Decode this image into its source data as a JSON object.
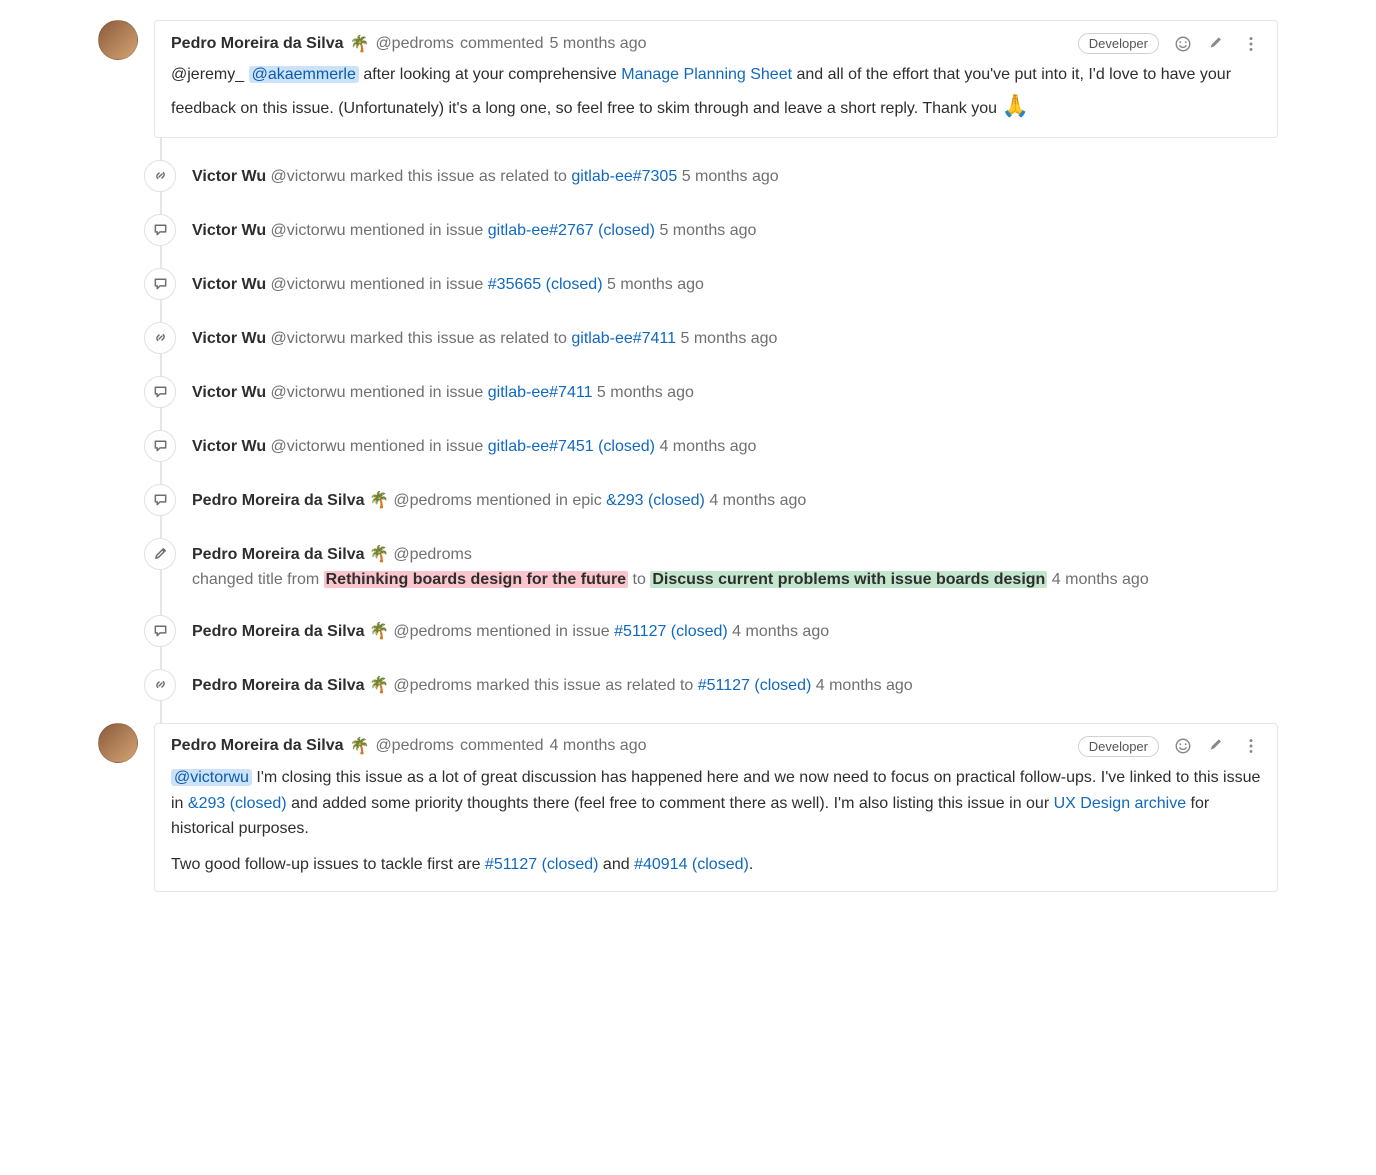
{
  "badge": {
    "developer": "Developer"
  },
  "comment1": {
    "author": "Pedro Moreira da Silva",
    "emoji": "🌴",
    "handle": "@pedroms",
    "verb": "commented",
    "time": "5 months ago",
    "seg": {
      "mention1": "@jeremy_",
      "mention2_hl": "@akaemmerle",
      "t1": " after looking at your comprehensive ",
      "link1": "Manage Planning Sheet",
      "t2": " and all of the effort that you've put into it, I'd love to have your feedback on this issue. (Unfortunately) it's a long one, so feel free to skim through and leave a short reply. Thank you "
    },
    "pray": "🙏"
  },
  "notes": [
    {
      "icon": "link",
      "author": "Victor Wu",
      "handle": "@victorwu",
      "action": " marked this issue as related to ",
      "ref": "gitlab-ee#7305",
      "time": "5 months ago"
    },
    {
      "icon": "speech",
      "author": "Victor Wu",
      "handle": "@victorwu",
      "action": " mentioned in issue ",
      "ref": "gitlab-ee#2767 (closed)",
      "time": "5 months ago"
    },
    {
      "icon": "speech",
      "author": "Victor Wu",
      "handle": "@victorwu",
      "action": " mentioned in issue ",
      "ref": "#35665 (closed)",
      "time": "5 months ago"
    },
    {
      "icon": "link",
      "author": "Victor Wu",
      "handle": "@victorwu",
      "action": " marked this issue as related to ",
      "ref": "gitlab-ee#7411",
      "time": "5 months ago"
    },
    {
      "icon": "speech",
      "author": "Victor Wu",
      "handle": "@victorwu",
      "action": " mentioned in issue ",
      "ref": "gitlab-ee#7411",
      "time": "5 months ago"
    },
    {
      "icon": "speech",
      "author": "Victor Wu",
      "handle": "@victorwu",
      "action": " mentioned in issue ",
      "ref": "gitlab-ee#7451 (closed)",
      "time": "4 months ago"
    },
    {
      "icon": "speech",
      "author": "Pedro Moreira da Silva",
      "emoji": "🌴",
      "handle": "@pedroms",
      "action": " mentioned in epic ",
      "ref": "&293 (closed)",
      "time": "4 months ago"
    },
    {
      "icon": "pencil",
      "author": "Pedro Moreira da Silva",
      "emoji": "🌴",
      "handle": "@pedroms",
      "title_change": true,
      "prefix": "changed title from ",
      "old": "Rethinking boards design for the future",
      "mid": " to ",
      "new": "Discuss current problems with issue boards design",
      "time": "4 months ago"
    },
    {
      "icon": "speech",
      "author": "Pedro Moreira da Silva",
      "emoji": "🌴",
      "handle": "@pedroms",
      "action": " mentioned in issue ",
      "ref": "#51127 (closed)",
      "time": "4 months ago"
    },
    {
      "icon": "link",
      "author": "Pedro Moreira da Silva",
      "emoji": "🌴",
      "handle": "@pedroms",
      "action": " marked this issue as related to ",
      "ref": "#51127 (closed)",
      "time": "4 months ago"
    }
  ],
  "comment2": {
    "author": "Pedro Moreira da Silva",
    "emoji": "🌴",
    "handle": "@pedroms",
    "verb": "commented",
    "time": "4 months ago",
    "p1": {
      "mention_hl": "@victorwu",
      "t1": " I'm closing this issue as a lot of great discussion has happened here and we now need to focus on practical follow-ups. I've linked to this issue in ",
      "link1": "&293 (closed)",
      "t2": " and added some priority thoughts there (feel free to comment there as well). I'm also listing this issue in our ",
      "link2": "UX Design archive",
      "t3": " for historical purposes."
    },
    "p2": {
      "t1": "Two good follow-up issues to tackle first are ",
      "link1": "#51127 (closed)",
      "mid": " and ",
      "link2": "#40914 (closed)",
      "tail": "."
    }
  }
}
